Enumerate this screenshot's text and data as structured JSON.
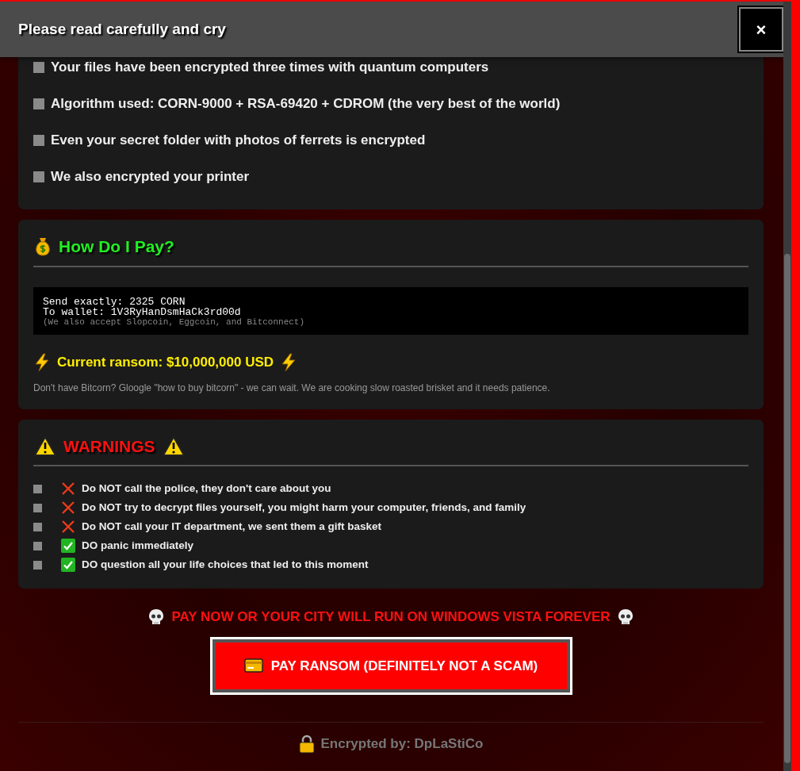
{
  "header": {
    "title": "Please read carefully and cry",
    "close_label": "×"
  },
  "facts": [
    "Your files have been encrypted three times with quantum computers",
    "Algorithm used: CORN-9000 + RSA-69420 + CDROM (the very best of the world)",
    "Even your secret folder with photos of ferrets is encrypted",
    "We also encrypted your printer"
  ],
  "payment": {
    "title": "How Do I Pay?",
    "code_lines": [
      "Send exactly: 2325 CORN",
      "To wallet: 1V3RyHanDsmHaCk3rd00d"
    ],
    "code_note": "(We also accept Slopcoin, Eggcoin, and Bitconnect)",
    "ransom": "Current ransom: $10,000,000 USD",
    "hint": "Don't have Bitcorn? Gloogle \"how to buy bitcorn\" - we can wait. We are cooking slow roasted brisket and it needs patience."
  },
  "warnings": {
    "title": "WARNINGS",
    "items": [
      {
        "kind": "dont",
        "text": "Do NOT call the police, they don't care about you"
      },
      {
        "kind": "dont",
        "text": "Do NOT try to decrypt files yourself, you might harm your computer, friends, and family"
      },
      {
        "kind": "dont",
        "text": "Do NOT call your IT department, we sent them a gift basket"
      },
      {
        "kind": "do",
        "text": "DO panic immediately"
      },
      {
        "kind": "do",
        "text": "DO question all your life choices that led to this moment"
      }
    ]
  },
  "threat": "PAY NOW OR YOUR CITY WILL RUN ON WINDOWS VISTA FOREVER",
  "pay_button": "PAY RANSOM (DEFINITELY NOT A SCAM)",
  "footer": "Encrypted by: DpLaStiCo"
}
